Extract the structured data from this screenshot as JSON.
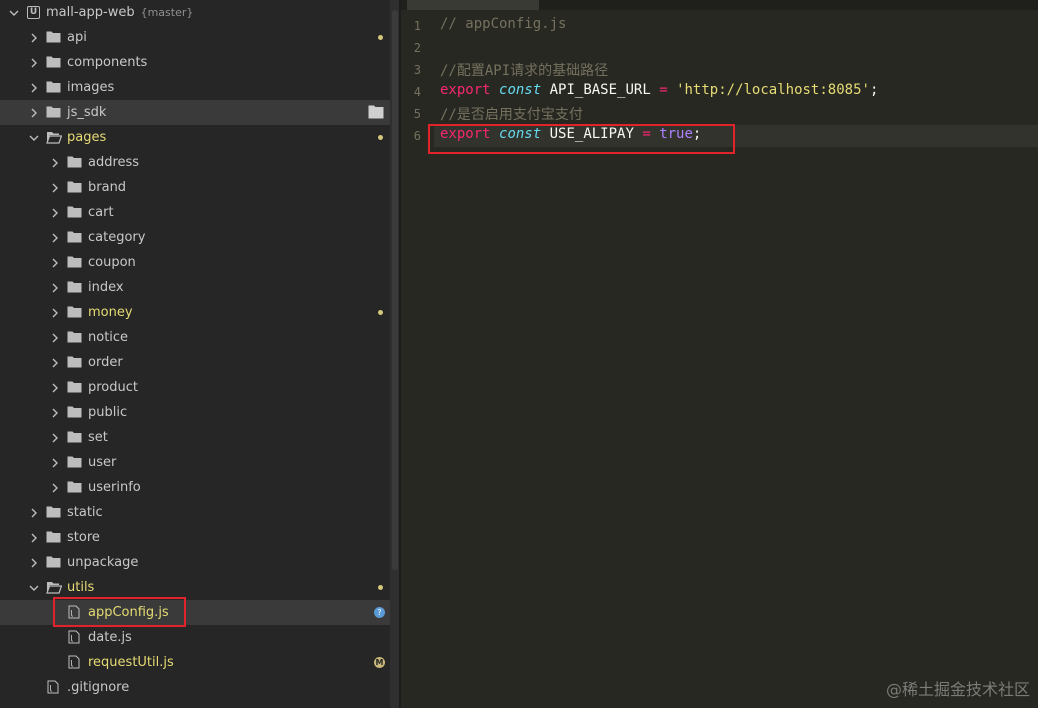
{
  "project": {
    "name": "mall-app-web",
    "branch": "{master}"
  },
  "tree": [
    {
      "label": "api",
      "type": "folder",
      "expanded": false,
      "depth": 1,
      "marker": "dot"
    },
    {
      "label": "components",
      "type": "folder",
      "expanded": false,
      "depth": 1
    },
    {
      "label": "images",
      "type": "folder",
      "expanded": false,
      "depth": 1
    },
    {
      "label": "js_sdk",
      "type": "folder",
      "expanded": false,
      "depth": 1,
      "hovered": true,
      "marker": "folder-action"
    },
    {
      "label": "pages",
      "type": "folder",
      "expanded": true,
      "depth": 1,
      "marker": "dot",
      "color": "yellow"
    },
    {
      "label": "address",
      "type": "folder",
      "expanded": false,
      "depth": 2
    },
    {
      "label": "brand",
      "type": "folder",
      "expanded": false,
      "depth": 2
    },
    {
      "label": "cart",
      "type": "folder",
      "expanded": false,
      "depth": 2
    },
    {
      "label": "category",
      "type": "folder",
      "expanded": false,
      "depth": 2
    },
    {
      "label": "coupon",
      "type": "folder",
      "expanded": false,
      "depth": 2
    },
    {
      "label": "index",
      "type": "folder",
      "expanded": false,
      "depth": 2
    },
    {
      "label": "money",
      "type": "folder",
      "expanded": false,
      "depth": 2,
      "marker": "dot",
      "color": "yellow"
    },
    {
      "label": "notice",
      "type": "folder",
      "expanded": false,
      "depth": 2
    },
    {
      "label": "order",
      "type": "folder",
      "expanded": false,
      "depth": 2
    },
    {
      "label": "product",
      "type": "folder",
      "expanded": false,
      "depth": 2
    },
    {
      "label": "public",
      "type": "folder",
      "expanded": false,
      "depth": 2
    },
    {
      "label": "set",
      "type": "folder",
      "expanded": false,
      "depth": 2
    },
    {
      "label": "user",
      "type": "folder",
      "expanded": false,
      "depth": 2
    },
    {
      "label": "userinfo",
      "type": "folder",
      "expanded": false,
      "depth": 2
    },
    {
      "label": "static",
      "type": "folder",
      "expanded": false,
      "depth": 1
    },
    {
      "label": "store",
      "type": "folder",
      "expanded": false,
      "depth": 1
    },
    {
      "label": "unpackage",
      "type": "folder",
      "expanded": false,
      "depth": 1
    },
    {
      "label": "utils",
      "type": "folder",
      "expanded": true,
      "depth": 1,
      "marker": "dot",
      "color": "yellow"
    },
    {
      "label": "appConfig.js",
      "type": "file",
      "depth": 2,
      "selected": true,
      "marker": "?",
      "color": "yellow"
    },
    {
      "label": "date.js",
      "type": "file",
      "depth": 2
    },
    {
      "label": "requestUtil.js",
      "type": "file",
      "depth": 2,
      "marker": "M",
      "color": "yellow"
    },
    {
      "label": ".gitignore",
      "type": "file",
      "depth": 1
    }
  ],
  "editor": {
    "line_numbers": [
      "1",
      "2",
      "3",
      "4",
      "5",
      "6"
    ],
    "lines": [
      [
        {
          "t": "// appConfig.js",
          "c": "comment"
        }
      ],
      [],
      [
        {
          "t": "//配置API请求的基础路径",
          "c": "comment"
        }
      ],
      [
        {
          "t": "export",
          "c": "kw"
        },
        {
          "t": " ",
          "c": ""
        },
        {
          "t": "const",
          "c": "decl"
        },
        {
          "t": " API_BASE_URL ",
          "c": ""
        },
        {
          "t": "=",
          "c": "op"
        },
        {
          "t": " ",
          "c": ""
        },
        {
          "t": "'http://localhost:8085'",
          "c": "str"
        },
        {
          "t": ";",
          "c": ""
        }
      ],
      [
        {
          "t": "//是否启用支付宝支付",
          "c": "comment"
        }
      ],
      [
        {
          "t": "export",
          "c": "kw"
        },
        {
          "t": " ",
          "c": ""
        },
        {
          "t": "const",
          "c": "decl"
        },
        {
          "t": " USE_ALIPAY ",
          "c": ""
        },
        {
          "t": "=",
          "c": "op"
        },
        {
          "t": " ",
          "c": ""
        },
        {
          "t": "true",
          "c": "bool"
        },
        {
          "t": ";",
          "c": ""
        }
      ]
    ]
  },
  "watermark": "@稀土掘金技术社区",
  "colors": {
    "highlight_box": "#e0242a",
    "modified_dot": "#d4c77c",
    "selected_text": "#e6db74"
  }
}
